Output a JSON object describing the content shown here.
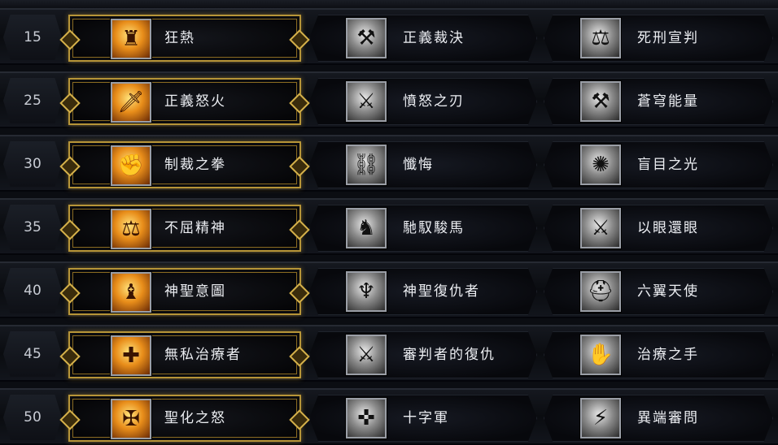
{
  "rows": [
    {
      "level": "15",
      "talents": [
        {
          "name": "狂熱",
          "icon": "zeal-icon",
          "selected": true
        },
        {
          "name": "正義裁決",
          "icon": "judgment-icon",
          "selected": false
        },
        {
          "name": "死刑宣判",
          "icon": "execution-sentence-icon",
          "selected": false
        }
      ]
    },
    {
      "level": "25",
      "talents": [
        {
          "name": "正義怒火",
          "icon": "flaming-sword-icon",
          "selected": true
        },
        {
          "name": "憤怒之刃",
          "icon": "blade-icon",
          "selected": false
        },
        {
          "name": "蒼穹能量",
          "icon": "hammer-icon",
          "selected": false
        }
      ]
    },
    {
      "level": "30",
      "talents": [
        {
          "name": "制裁之拳",
          "icon": "fist-icon",
          "selected": true
        },
        {
          "name": "懺悔",
          "icon": "repentance-icon",
          "selected": false
        },
        {
          "name": "盲目之光",
          "icon": "blinding-light-icon",
          "selected": false
        }
      ]
    },
    {
      "level": "35",
      "talents": [
        {
          "name": "不屈精神",
          "icon": "scales-icon",
          "selected": true
        },
        {
          "name": "馳馭駿馬",
          "icon": "horse-icon",
          "selected": false
        },
        {
          "name": "以眼還眼",
          "icon": "crossed-swords-icon",
          "selected": false
        }
      ]
    },
    {
      "level": "40",
      "talents": [
        {
          "name": "神聖意圖",
          "icon": "paladin-figure-icon",
          "selected": true
        },
        {
          "name": "神聖復仇者",
          "icon": "angel-wings-icon",
          "selected": false
        },
        {
          "name": "六翼天使",
          "icon": "helm-icon",
          "selected": false
        }
      ]
    },
    {
      "level": "45",
      "talents": [
        {
          "name": "無私治療者",
          "icon": "healer-icon",
          "selected": true
        },
        {
          "name": "審判者的復仇",
          "icon": "sword-icon",
          "selected": false
        },
        {
          "name": "治療之手",
          "icon": "healing-hand-icon",
          "selected": false
        }
      ]
    },
    {
      "level": "50",
      "talents": [
        {
          "name": "聖化之怒",
          "icon": "crusader-wings-icon",
          "selected": true
        },
        {
          "name": "十字軍",
          "icon": "crusader-icon",
          "selected": false
        },
        {
          "name": "異端審問",
          "icon": "inquisition-icon",
          "selected": false
        }
      ]
    }
  ],
  "icon_glyphs": {
    "zeal-icon": "♜",
    "judgment-icon": "⚒",
    "execution-sentence-icon": "⚖",
    "flaming-sword-icon": "🗡",
    "blade-icon": "⚔",
    "hammer-icon": "⚒",
    "fist-icon": "✊",
    "repentance-icon": "⛓",
    "blinding-light-icon": "✺",
    "scales-icon": "⚖",
    "horse-icon": "♞",
    "crossed-swords-icon": "⚔",
    "paladin-figure-icon": "♝",
    "angel-wings-icon": "♆",
    "helm-icon": "⛑",
    "healer-icon": "✚",
    "sword-icon": "⚔",
    "healing-hand-icon": "✋",
    "crusader-wings-icon": "✠",
    "crusader-icon": "✜",
    "inquisition-icon": "⚡"
  },
  "colors": {
    "selected_border": "#b79538",
    "label_text": "#eceef2",
    "level_text": "#c8ccd4"
  }
}
